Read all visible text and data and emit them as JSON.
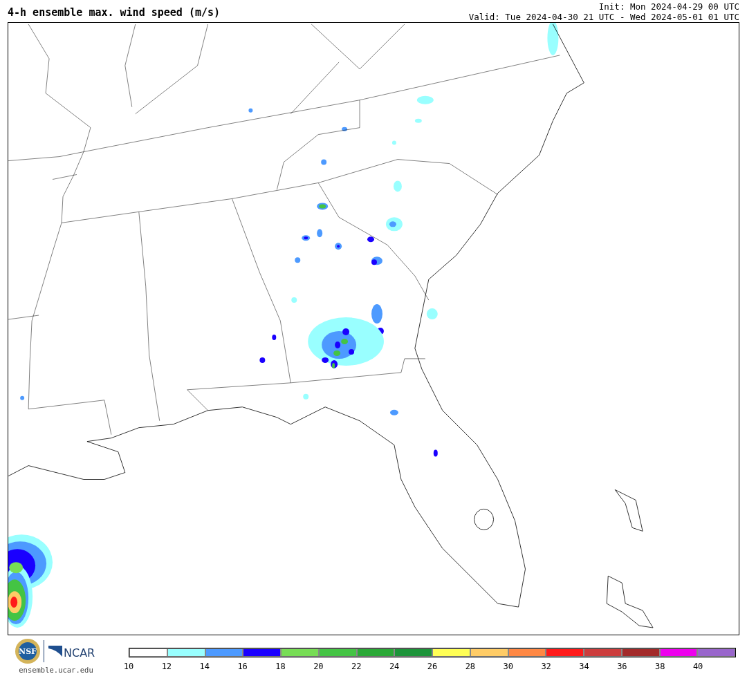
{
  "header": {
    "title": "4-h ensemble max. wind speed (m/s)",
    "init": "Init: Mon 2024-04-29 00 UTC",
    "valid": "Valid: Tue 2024-04-30 21 UTC - Wed 2024-05-01 01 UTC"
  },
  "footer": {
    "nsf_logo_text": "NSF",
    "ncar_logo_text": "NCAR",
    "site": "ensemble.ucar.edu"
  },
  "colorbar": {
    "bins": [
      {
        "color": "#ffffff"
      },
      {
        "color": "#99ffff"
      },
      {
        "color": "#4d9aff"
      },
      {
        "color": "#1a00ff"
      },
      {
        "color": "#77dd55"
      },
      {
        "color": "#44c444"
      },
      {
        "color": "#2aa836"
      },
      {
        "color": "#1d943a"
      },
      {
        "color": "#ffff55"
      },
      {
        "color": "#ffcc66"
      },
      {
        "color": "#ff8844"
      },
      {
        "color": "#ff1a1a"
      },
      {
        "color": "#cc3d3d"
      },
      {
        "color": "#a32a2a"
      },
      {
        "color": "#ee00ee"
      },
      {
        "color": "#9966cc"
      }
    ],
    "ticks": [
      "10",
      "12",
      "14",
      "16",
      "18",
      "20",
      "22",
      "24",
      "26",
      "28",
      "30",
      "32",
      "34",
      "36",
      "38",
      "40"
    ]
  }
}
